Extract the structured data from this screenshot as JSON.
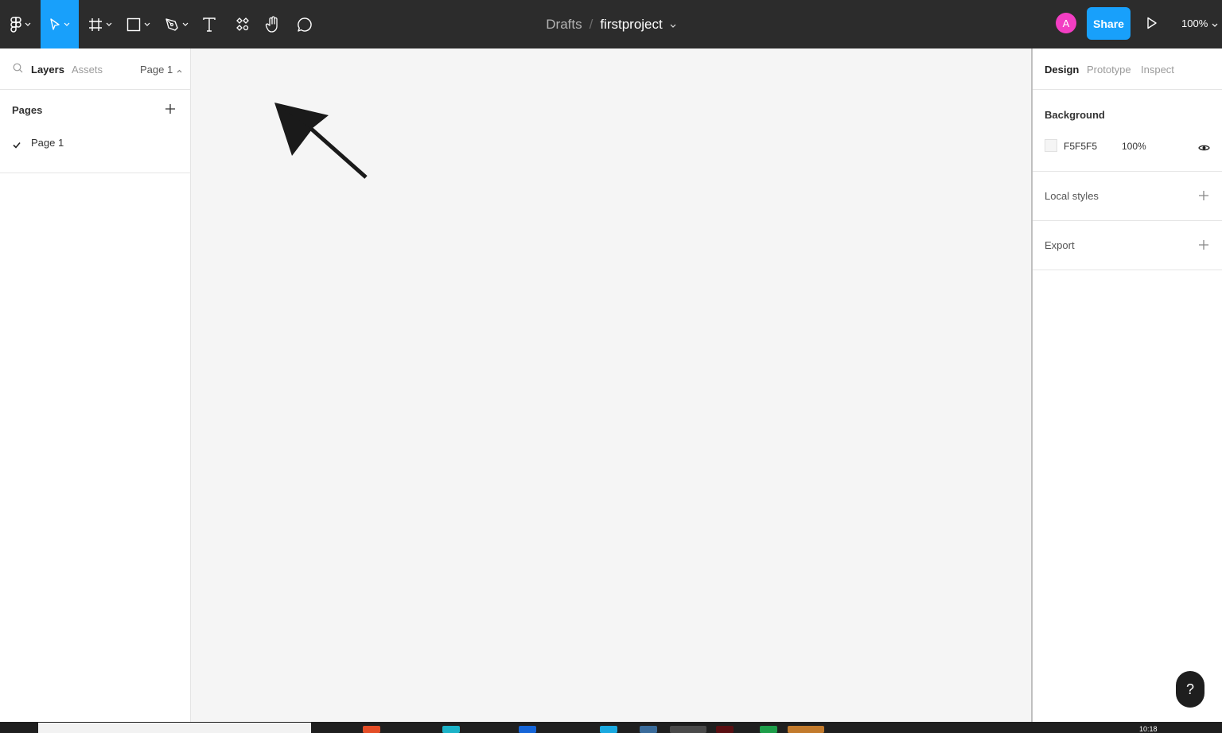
{
  "toolbar": {
    "tools": [
      "main-menu",
      "move",
      "frame",
      "shape",
      "pen",
      "text",
      "resources",
      "hand",
      "comment"
    ],
    "breadcrumb": {
      "folder": "Drafts",
      "separator": "/",
      "project": "firstproject"
    },
    "avatar_initial": "A",
    "share_label": "Share",
    "zoom_label": "100%",
    "accent_color": "#18a0fb",
    "avatar_color": "#f33ec3"
  },
  "left_panel": {
    "tabs": {
      "layers": "Layers",
      "assets": "Assets"
    },
    "page_selector": "Page 1",
    "pages_title": "Pages",
    "pages": [
      {
        "label": "Page 1",
        "selected": true
      }
    ]
  },
  "right_panel": {
    "tabs": [
      "Design",
      "Prototype",
      "Inspect"
    ],
    "active_tab": "Design",
    "background": {
      "title": "Background",
      "hex": "F5F5F5",
      "opacity": "100%"
    },
    "local_styles": "Local styles",
    "export": "Export",
    "help": "?"
  },
  "taskbar": {
    "clock": "10:18"
  }
}
